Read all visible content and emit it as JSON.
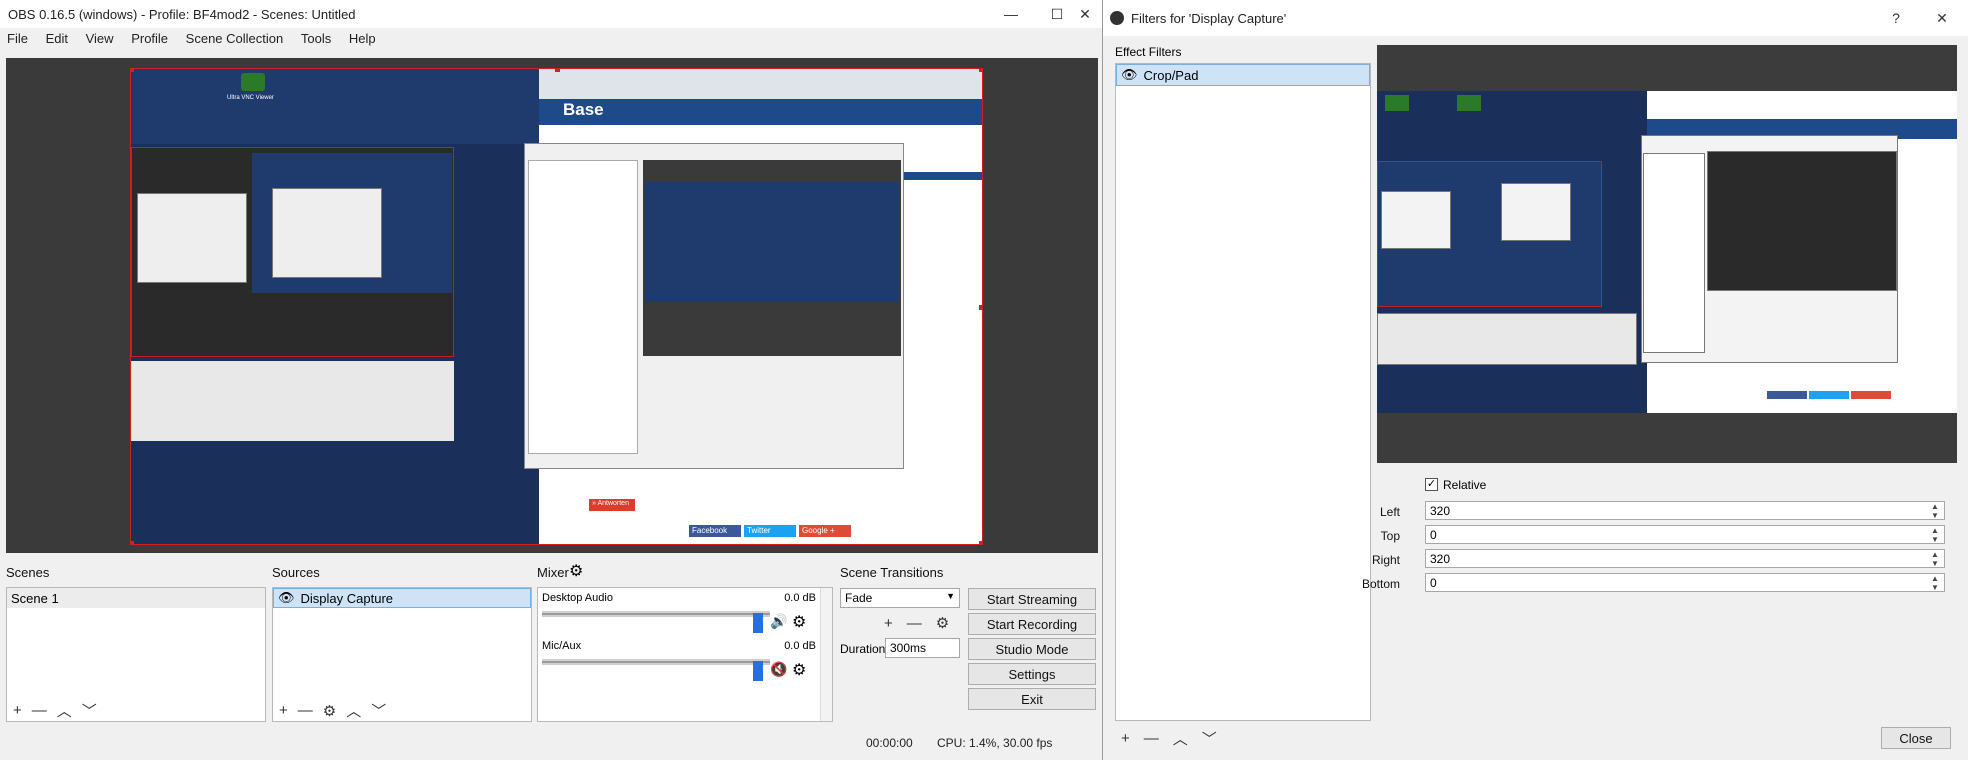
{
  "obs": {
    "title": "OBS 0.16.5 (windows) - Profile: BF4mod2 - Scenes: Untitled",
    "window_controls": {
      "min": "—",
      "max": "☐",
      "close": "✕"
    },
    "menu": [
      "File",
      "Edit",
      "View",
      "Profile",
      "Scene Collection",
      "Tools",
      "Help"
    ],
    "scenes": {
      "title": "Scenes",
      "items": [
        "Scene 1"
      ]
    },
    "sources": {
      "title": "Sources",
      "items": [
        "Display Capture"
      ]
    },
    "mixer": {
      "title": "Mixer",
      "channels": [
        {
          "name": "Desktop Audio",
          "level": "0.0 dB",
          "muted": false
        },
        {
          "name": "Mic/Aux",
          "level": "0.0 dB",
          "muted": true
        }
      ]
    },
    "transitions": {
      "title": "Scene Transitions",
      "selected": "Fade",
      "duration_label": "Duration",
      "duration": "300ms"
    },
    "controls": [
      "Start Streaming",
      "Start Recording",
      "Studio Mode",
      "Settings",
      "Exit"
    ],
    "status": {
      "time": "00:00:00",
      "cpu": "CPU: 1.4%, 30.00 fps"
    },
    "toolbar_glyphs": {
      "add": "+",
      "remove": "—",
      "up": "︿",
      "down": "﹀",
      "gear": "⚙"
    },
    "preview_snippets": {
      "desktop_icon_1": "Ultra VNC Viewer",
      "share_facebook": "Facebook",
      "share_twitter": "Twitter",
      "share_google": "Google +",
      "read_more": "» Antworten",
      "site_logo": "Base"
    }
  },
  "filters_dialog": {
    "title": "Filters for 'Display Capture'",
    "help": "?",
    "close_x": "✕",
    "effect_filters_label": "Effect Filters",
    "filters": [
      "Crop/Pad"
    ],
    "relative_label": "Relative",
    "relative_checked": true,
    "properties": [
      {
        "label": "Left",
        "value": "320"
      },
      {
        "label": "Top",
        "value": "0"
      },
      {
        "label": "Right",
        "value": "320"
      },
      {
        "label": "Bottom",
        "value": "0"
      }
    ],
    "close_button": "Close"
  },
  "colors": {
    "accent": "#2a6fdc",
    "selection": "#cfe3f7",
    "preview_border": "#d02020",
    "muted_icon": "#d02020"
  }
}
